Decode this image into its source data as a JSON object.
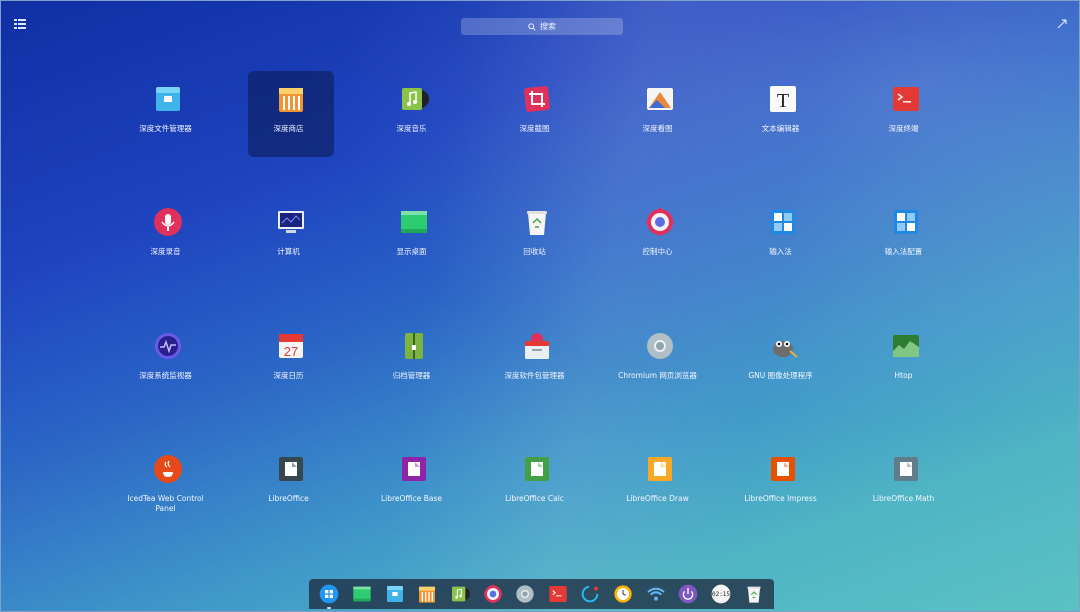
{
  "search": {
    "placeholder": "搜索"
  },
  "apps": [
    {
      "label": "深度文件管理器",
      "icon": "file-manager-icon",
      "selected": false
    },
    {
      "label": "深度商店",
      "icon": "store-icon",
      "selected": true
    },
    {
      "label": "深度音乐",
      "icon": "music-icon",
      "selected": false
    },
    {
      "label": "深度截图",
      "icon": "screenshot-icon",
      "selected": false
    },
    {
      "label": "深度看图",
      "icon": "image-viewer-icon",
      "selected": false
    },
    {
      "label": "文本编辑器",
      "icon": "text-editor-icon",
      "selected": false
    },
    {
      "label": "深度终端",
      "icon": "terminal-icon",
      "selected": false
    },
    {
      "label": "深度录音",
      "icon": "microphone-icon",
      "selected": false
    },
    {
      "label": "计算机",
      "icon": "computer-icon",
      "selected": false
    },
    {
      "label": "显示桌面",
      "icon": "show-desktop-icon",
      "selected": false
    },
    {
      "label": "回收站",
      "icon": "trash-icon",
      "selected": false
    },
    {
      "label": "控制中心",
      "icon": "control-center-icon",
      "selected": false
    },
    {
      "label": "输入法",
      "icon": "input-method-icon",
      "selected": false
    },
    {
      "label": "输入法配置",
      "icon": "input-method-config-icon",
      "selected": false
    },
    {
      "label": "深度系统监视器",
      "icon": "system-monitor-icon",
      "selected": false
    },
    {
      "label": "深度日历",
      "icon": "calendar-icon",
      "selected": false,
      "icon_text": "27"
    },
    {
      "label": "归档管理器",
      "icon": "archive-icon",
      "selected": false
    },
    {
      "label": "深度软件包管理器",
      "icon": "package-manager-icon",
      "selected": false
    },
    {
      "label": "Chromium 网页浏览器",
      "icon": "chromium-icon",
      "selected": false
    },
    {
      "label": "GNU 图像处理程序",
      "icon": "gimp-icon",
      "selected": false
    },
    {
      "label": "Htop",
      "icon": "htop-icon",
      "selected": false
    },
    {
      "label": "IcedTea Web Control Panel",
      "icon": "java-icon",
      "selected": false
    },
    {
      "label": "LibreOffice",
      "icon": "libreoffice-icon",
      "selected": false
    },
    {
      "label": "LibreOffice Base",
      "icon": "libreoffice-base-icon",
      "selected": false
    },
    {
      "label": "LibreOffice Calc",
      "icon": "libreoffice-calc-icon",
      "selected": false
    },
    {
      "label": "LibreOffice Draw",
      "icon": "libreoffice-draw-icon",
      "selected": false
    },
    {
      "label": "LibreOffice Impress",
      "icon": "libreoffice-impress-icon",
      "selected": false
    },
    {
      "label": "LibreOffice Math",
      "icon": "libreoffice-math-icon",
      "selected": false
    }
  ],
  "dock": [
    {
      "icon": "launcher-icon"
    },
    {
      "icon": "show-desktop-icon"
    },
    {
      "icon": "file-manager-icon"
    },
    {
      "icon": "store-icon"
    },
    {
      "icon": "music-icon"
    },
    {
      "icon": "control-center-icon"
    },
    {
      "icon": "chromium-icon"
    },
    {
      "icon": "terminal-icon"
    },
    {
      "icon": "loading-icon"
    },
    {
      "icon": "clock-icon"
    },
    {
      "icon": "wifi-icon"
    },
    {
      "icon": "power-icon"
    },
    {
      "icon": "time-icon",
      "text": "02:15"
    },
    {
      "icon": "trash-icon"
    }
  ],
  "colors": {
    "selection": "#0a1950",
    "accent": "#2a63c6"
  }
}
